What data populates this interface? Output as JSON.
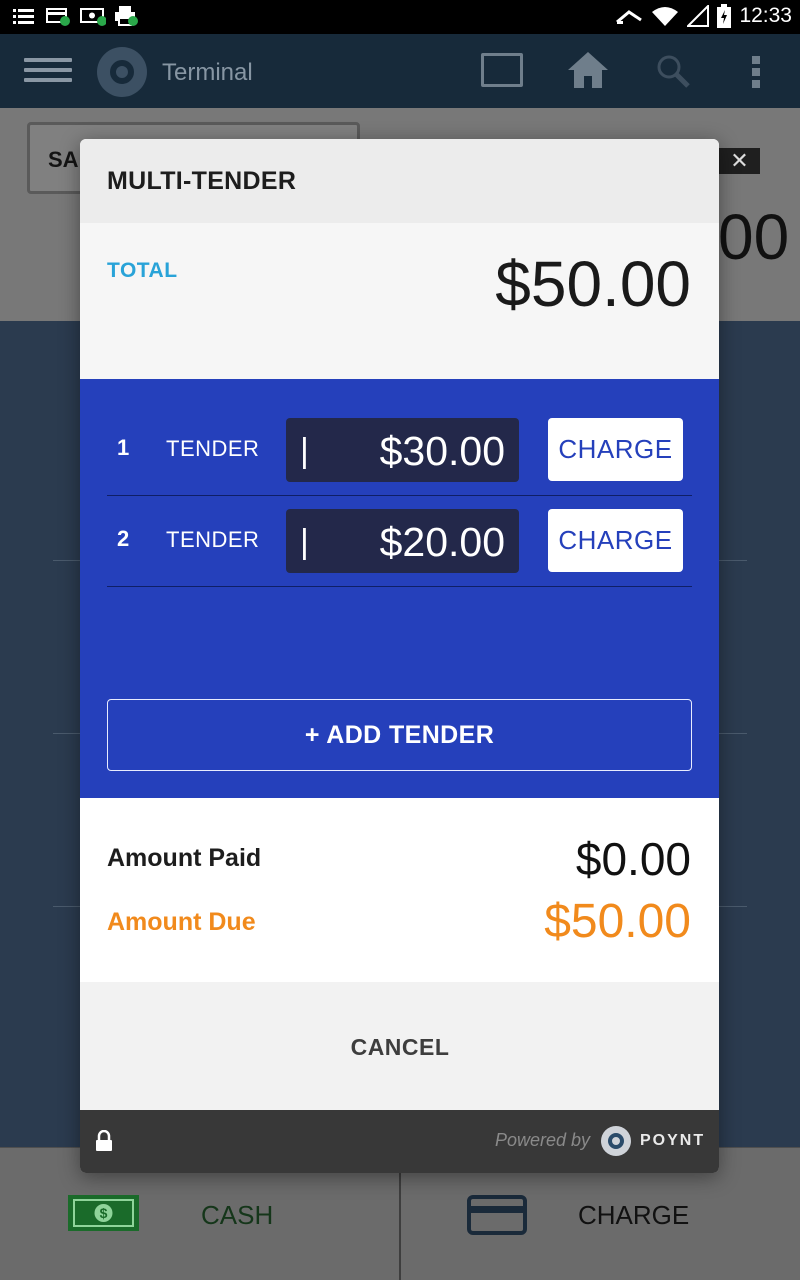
{
  "status_bar": {
    "time": "12:33",
    "icons": [
      "list-icon",
      "card-check-icon",
      "cash-check-icon",
      "printer-check-icon",
      "cast-icon",
      "wifi-icon",
      "signal-icon",
      "battery-icon"
    ]
  },
  "app_bar": {
    "title": "Terminal",
    "icons": [
      "menu-icon",
      "logo-icon",
      "window-icon",
      "home-icon",
      "search-icon",
      "more-icon"
    ]
  },
  "background": {
    "sale_tab_label": "SA",
    "close_label": "✕",
    "amount_partial": "00",
    "bottom_bar": {
      "cash_label": "CASH",
      "charge_label": "CHARGE"
    }
  },
  "modal": {
    "title": "MULTI-TENDER",
    "total_label": "TOTAL",
    "total_amount": "$50.00",
    "tenders": [
      {
        "number": "1",
        "label": "TENDER",
        "cursor": "|",
        "amount": "$30.00",
        "charge_label": "CHARGE"
      },
      {
        "number": "2",
        "label": "TENDER",
        "cursor": "|",
        "amount": "$20.00",
        "charge_label": "CHARGE"
      }
    ],
    "add_tender_label": "+ ADD TENDER",
    "amount_paid_label": "Amount Paid",
    "amount_paid_value": "$0.00",
    "amount_due_label": "Amount Due",
    "amount_due_value": "$50.00",
    "cancel_label": "CANCEL",
    "footer": {
      "powered_by": "Powered by",
      "brand": "POYNT"
    }
  },
  "colors": {
    "tender_blue": "#2540bb",
    "total_label_blue": "#29a3d8",
    "amount_due_orange": "#f18a1c",
    "app_bar": "#172a3a"
  }
}
